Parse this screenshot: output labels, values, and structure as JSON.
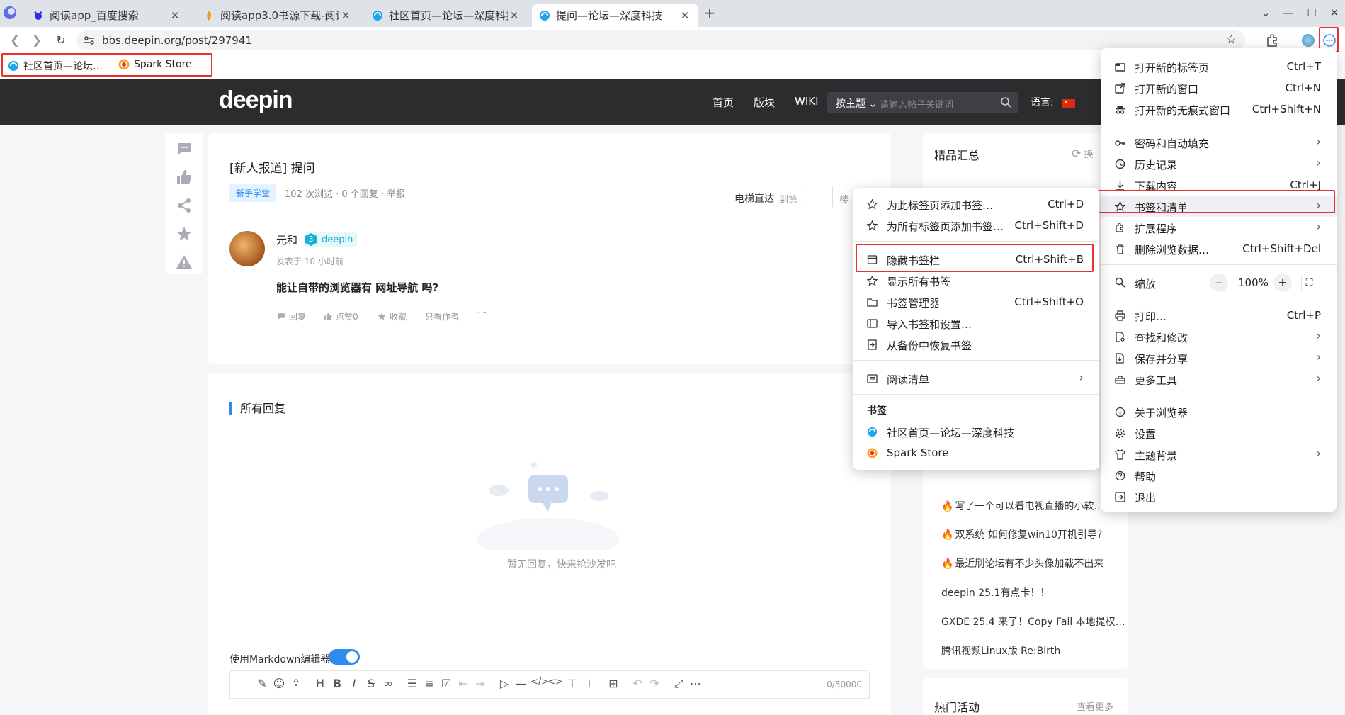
{
  "tabs": [
    {
      "title": "阅读app_百度搜索",
      "favicon": "baidu-favicon"
    },
    {
      "title": "阅读app3.0书源下载-阅读",
      "favicon": "flame-favicon"
    },
    {
      "title": "社区首页—论坛—深度科技",
      "favicon": "deepin-favicon"
    },
    {
      "title": "提问—论坛—深度科技",
      "favicon": "deepin-favicon"
    }
  ],
  "address_bar": {
    "url": "bbs.deepin.org/post/297941"
  },
  "bookmarks_bar": [
    {
      "label": "社区首页—论坛…",
      "favicon": "deepin-favicon"
    },
    {
      "label": "Spark Store",
      "favicon": "spark-favicon"
    }
  ],
  "site": {
    "logo": "deepin",
    "nav": [
      "首页",
      "版块",
      "WIKI"
    ],
    "search_select": "按主题",
    "search_placeholder": "请输入帖子关键词",
    "lang_label": "语言:"
  },
  "post": {
    "title": "[新人报道] 提问",
    "tag": "新手学堂",
    "meta": "102 次浏览 · 0 个回复 · 举报",
    "elevator": "电梯直达",
    "elevator_to": "到第",
    "elevator_floor": "楼",
    "author": "元和",
    "level": "3",
    "level_name": "deepin",
    "time": "发表于 10 小时前",
    "body": "能让自带的浏览器有 网址导航 吗?",
    "actions": {
      "reply": "回复",
      "like": "点赞0",
      "fav": "收藏",
      "author_only": "只看作者",
      "more": "···"
    }
  },
  "replies": {
    "title": "所有回复",
    "empty": "暂无回复，快来抢沙发吧",
    "md_label": "使用Markdown编辑器",
    "md_enabled": true,
    "char_count": "0/50000"
  },
  "sidebar": {
    "title": "精品汇总",
    "refresh": "换",
    "hot_items": [
      {
        "text": "写了一个可以看电视直播的小软…",
        "hot": true
      },
      {
        "text": "双系统 如何修复win10开机引导?",
        "hot": true
      },
      {
        "text": "最近刷论坛有不少头像加载不出来",
        "hot": true
      },
      {
        "text": "deepin 25.1有点卡！！",
        "hot": false
      },
      {
        "text": "GXDE 25.4 来了！Copy Fail 本地提权…",
        "hot": false
      },
      {
        "text": "腾讯视频Linux版 Re:Birth",
        "hot": false
      }
    ],
    "activity_title": "热门活动",
    "activity_more": "查看更多"
  },
  "main_menu": {
    "items": [
      {
        "label": "打开新的标签页",
        "shortcut": "Ctrl+T",
        "icon": "new-tab-icon"
      },
      {
        "label": "打开新的窗口",
        "shortcut": "Ctrl+N",
        "icon": "new-window-icon"
      },
      {
        "label": "打开新的无痕式窗口",
        "shortcut": "Ctrl+Shift+N",
        "icon": "incognito-icon"
      },
      {
        "label": "密码和自动填充",
        "submenu": true,
        "icon": "key-icon"
      },
      {
        "label": "历史记录",
        "submenu": true,
        "icon": "history-icon"
      },
      {
        "label": "下载内容",
        "shortcut": "Ctrl+J",
        "icon": "download-icon"
      },
      {
        "label": "书签和清单",
        "submenu": true,
        "icon": "star-icon",
        "highlighted": true
      },
      {
        "label": "扩展程序",
        "submenu": true,
        "icon": "puzzle-icon"
      },
      {
        "label": "删除浏览数据…",
        "shortcut": "Ctrl+Shift+Del",
        "icon": "trash-icon"
      },
      {
        "label": "缩放",
        "icon": "zoom-icon"
      },
      {
        "label": "打印…",
        "shortcut": "Ctrl+P",
        "icon": "print-icon"
      },
      {
        "label": "查找和修改",
        "submenu": true,
        "icon": "find-icon"
      },
      {
        "label": "保存并分享",
        "submenu": true,
        "icon": "save-share-icon"
      },
      {
        "label": "更多工具",
        "submenu": true,
        "icon": "toolbox-icon"
      },
      {
        "label": "关于浏览器",
        "icon": "info-icon"
      },
      {
        "label": "设置",
        "icon": "settings-icon"
      },
      {
        "label": "主题背景",
        "submenu": true,
        "icon": "shirt-icon"
      },
      {
        "label": "帮助",
        "icon": "help-icon"
      },
      {
        "label": "退出",
        "icon": "exit-icon"
      }
    ],
    "zoom": {
      "minus": "−",
      "value": "100%",
      "plus": "+"
    }
  },
  "bookmark_submenu": {
    "items": [
      {
        "label": "为此标签页添加书签…",
        "shortcut": "Ctrl+D",
        "icon": "star-icon"
      },
      {
        "label": "为所有标签页添加书签…",
        "shortcut": "Ctrl+Shift+D",
        "icon": "star-icon"
      },
      {
        "label": "隐藏书签栏",
        "shortcut": "Ctrl+Shift+B",
        "icon": "bookmark-bar-icon"
      },
      {
        "label": "显示所有书签",
        "icon": "star-icon"
      },
      {
        "label": "书签管理器",
        "shortcut": "Ctrl+Shift+O",
        "icon": "folder-icon"
      },
      {
        "label": "导入书签和设置…",
        "icon": "import-icon"
      },
      {
        "label": "从备份中恢复书签",
        "icon": "restore-icon"
      },
      {
        "label": "阅读清单",
        "submenu": true,
        "icon": "reading-list-icon"
      }
    ],
    "section_label": "书签",
    "bookmarks": [
      {
        "label": "社区首页—论坛—深度科技",
        "favicon": "deepin-favicon"
      },
      {
        "label": "Spark Store",
        "favicon": "spark-favicon"
      }
    ]
  },
  "colors": {
    "accent": "#2d8cf0",
    "highlight_box": "#e8312f",
    "header_bg": "#2b2c2e"
  }
}
